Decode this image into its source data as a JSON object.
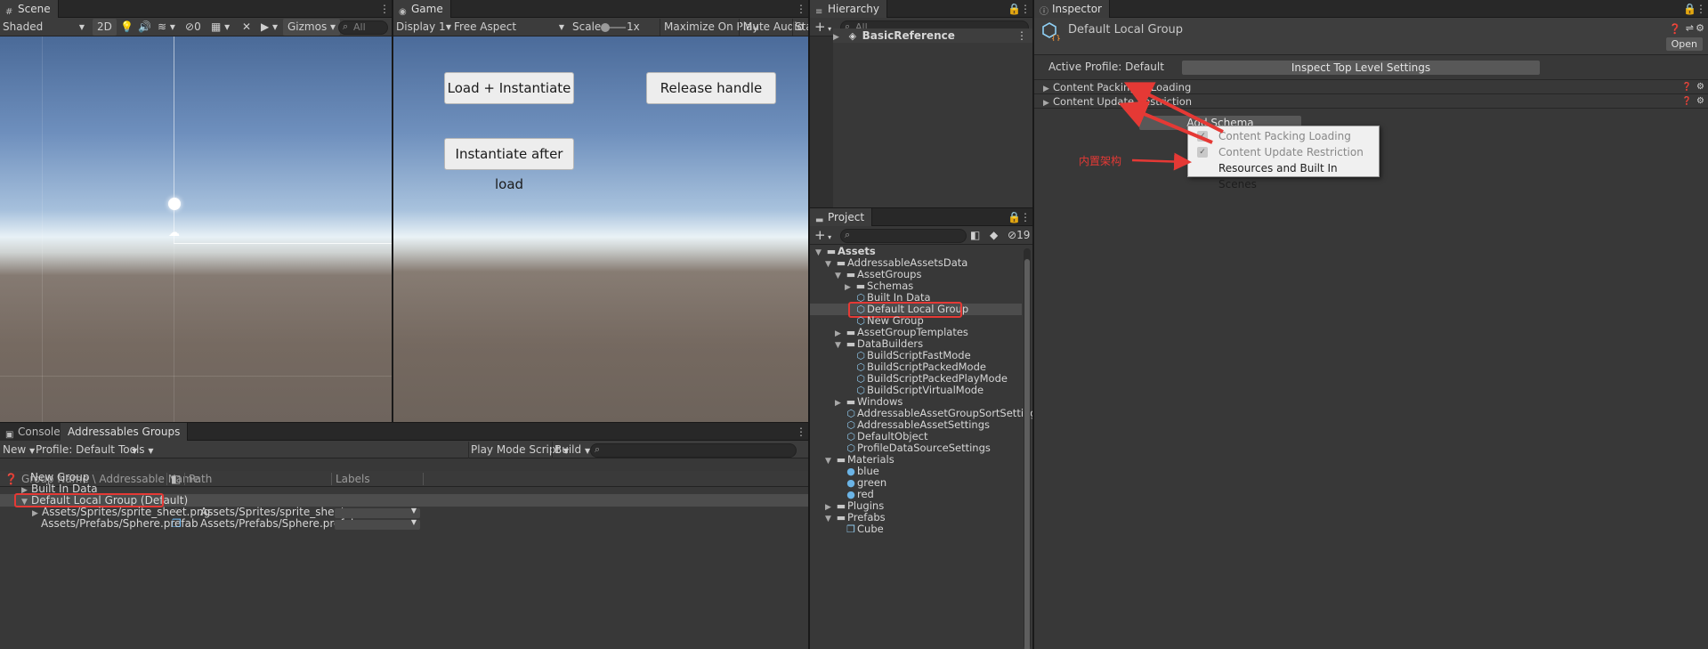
{
  "scene": {
    "tab": "Scene",
    "shading": "Shaded",
    "mode_2d": "2D",
    "hidden_count": "0",
    "gizmos": "Gizmos",
    "search_placeholder": "All"
  },
  "game": {
    "tab": "Game",
    "display": "Display 1",
    "aspect": "Free Aspect",
    "scale_label": "Scale",
    "scale_value": "1x",
    "maximize": "Maximize On Play",
    "mute": "Mute Audio",
    "stats": "Sta",
    "buttons": {
      "load": "Load + Instantiate",
      "release": "Release handle",
      "instantiate_after": "Instantiate after load"
    }
  },
  "hierarchy": {
    "tab": "Hierarchy",
    "add": "+",
    "search_placeholder": "All",
    "root": "BasicReference"
  },
  "project": {
    "tab": "Project",
    "add": "+",
    "hidden_count": "19",
    "items": [
      {
        "label": "Assets",
        "type": "folder",
        "fold": "open",
        "bold": true
      },
      {
        "label": "AddressableAssetsData",
        "type": "folder",
        "fold": "open"
      },
      {
        "label": "AssetGroups",
        "type": "folder",
        "fold": "open"
      },
      {
        "label": "Schemas",
        "type": "folder",
        "fold": "closed"
      },
      {
        "label": "Built In Data",
        "type": "asset",
        "fold": ""
      },
      {
        "label": "Default Local Group",
        "type": "asset",
        "fold": "",
        "selected": true
      },
      {
        "label": "New Group",
        "type": "asset",
        "fold": ""
      },
      {
        "label": "AssetGroupTemplates",
        "type": "folder",
        "fold": "closed"
      },
      {
        "label": "DataBuilders",
        "type": "folder",
        "fold": "open"
      },
      {
        "label": "BuildScriptFastMode",
        "type": "asset",
        "fold": ""
      },
      {
        "label": "BuildScriptPackedMode",
        "type": "asset",
        "fold": ""
      },
      {
        "label": "BuildScriptPackedPlayMode",
        "type": "asset",
        "fold": ""
      },
      {
        "label": "BuildScriptVirtualMode",
        "type": "asset",
        "fold": ""
      },
      {
        "label": "Windows",
        "type": "folder",
        "fold": "closed"
      },
      {
        "label": "AddressableAssetGroupSortSettings",
        "type": "asset",
        "fold": ""
      },
      {
        "label": "AddressableAssetSettings",
        "type": "asset",
        "fold": ""
      },
      {
        "label": "DefaultObject",
        "type": "asset",
        "fold": ""
      },
      {
        "label": "ProfileDataSourceSettings",
        "type": "asset",
        "fold": ""
      },
      {
        "label": "Materials",
        "type": "folder",
        "fold": "open"
      },
      {
        "label": "blue",
        "type": "material",
        "fold": ""
      },
      {
        "label": "green",
        "type": "material",
        "fold": ""
      },
      {
        "label": "red",
        "type": "material",
        "fold": ""
      },
      {
        "label": "Plugins",
        "type": "folder",
        "fold": "closed"
      },
      {
        "label": "Prefabs",
        "type": "folder",
        "fold": "open"
      },
      {
        "label": "Cube",
        "type": "prefab",
        "fold": ""
      }
    ]
  },
  "inspector": {
    "tab": "Inspector",
    "title": "Default Local Group",
    "open_button": "Open",
    "active_profile": "Active Profile: Default",
    "inspect_button": "Inspect Top Level Settings",
    "sections": [
      {
        "label": "Content Packing & Loading"
      },
      {
        "label": "Content Update Restriction"
      }
    ],
    "add_schema": "Add Schema",
    "popup": [
      {
        "label": "Content Packing  Loading",
        "checked": true
      },
      {
        "label": "Content Update Restriction",
        "checked": true
      },
      {
        "label": "Resources and Built In Scenes",
        "checked": false
      }
    ],
    "annotation": "内置架构"
  },
  "bottom": {
    "tabs": [
      "Console",
      "Addressables Groups"
    ],
    "new": "New",
    "profile": "Profile: Default",
    "tools": "Tools",
    "play_mode": "Play Mode Script",
    "build": "Build",
    "columns": {
      "name": "Group Name \\ Addressable Name",
      "path": "Path",
      "labels": "Labels"
    },
    "groups": [
      {
        "name": "New Group",
        "fold": ""
      },
      {
        "name": "Built In Data",
        "fold": "closed"
      },
      {
        "name": "Default Local Group (Default)",
        "fold": "open"
      }
    ],
    "entries": [
      {
        "name": "Assets/Sprites/sprite_sheet.png",
        "path": "Assets/Sprites/sprite_sheet.png",
        "fold": "closed"
      },
      {
        "name": "Assets/Prefabs/Sphere.prefab",
        "path": "Assets/Prefabs/Sphere.prefab",
        "fold": ""
      }
    ]
  },
  "colors": {
    "annotation_red": "#e53935",
    "selection": "#4d4d4d",
    "sky_top": "#4d6d9c",
    "ground": "#6e5f56"
  }
}
